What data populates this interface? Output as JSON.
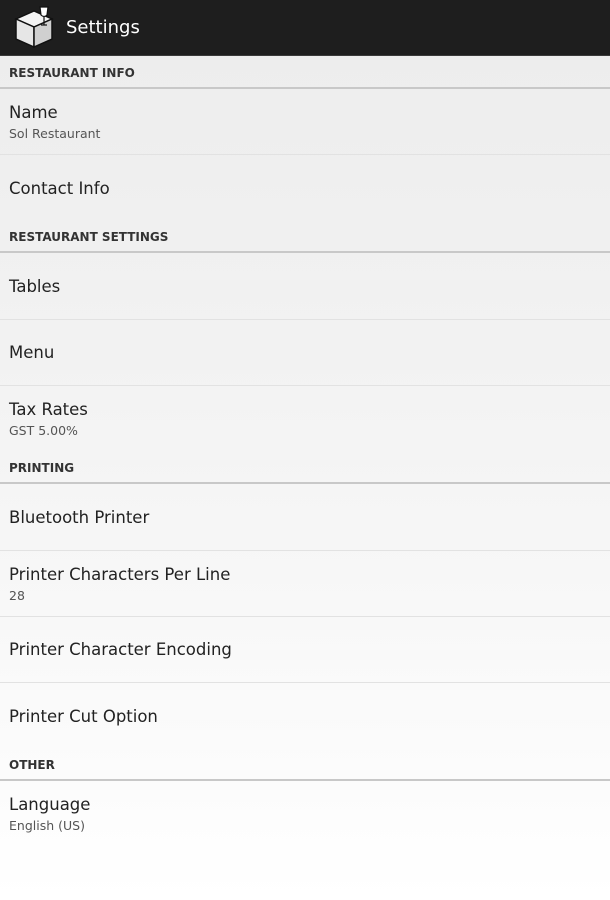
{
  "actionbar": {
    "title": "Settings",
    "icon": "restaurant-box-icon"
  },
  "sections": {
    "restaurant_info": {
      "header": "RESTAURANT INFO",
      "name": {
        "title": "Name",
        "summary": "Sol Restaurant"
      },
      "contact": {
        "title": "Contact Info"
      }
    },
    "restaurant_settings": {
      "header": "RESTAURANT SETTINGS",
      "tables": {
        "title": "Tables"
      },
      "menu": {
        "title": "Menu"
      },
      "tax": {
        "title": "Tax Rates",
        "summary": "GST 5.00%"
      }
    },
    "printing": {
      "header": "PRINTING",
      "bluetooth": {
        "title": "Bluetooth Printer"
      },
      "chars_per_line": {
        "title": "Printer Characters Per Line",
        "summary": "28"
      },
      "encoding": {
        "title": "Printer Character Encoding"
      },
      "cut": {
        "title": "Printer Cut Option"
      }
    },
    "other": {
      "header": "OTHER",
      "language": {
        "title": "Language",
        "summary": "English (US)"
      }
    }
  }
}
